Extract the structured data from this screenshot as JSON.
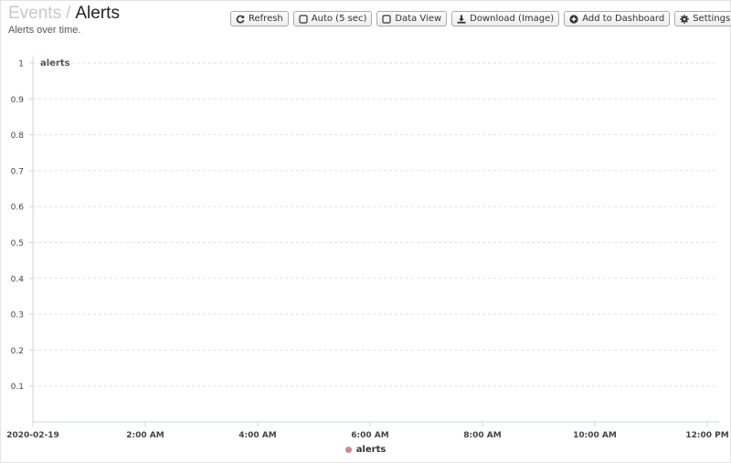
{
  "header": {
    "breadcrumb_parent": "Events",
    "breadcrumb_separator": "/",
    "breadcrumb_current": "Alerts",
    "subtitle": "Alerts over time."
  },
  "toolbar": {
    "refresh": {
      "label": "Refresh",
      "icon": "refresh-icon"
    },
    "auto": {
      "label": "Auto (5 sec)",
      "icon": "checkbox-icon"
    },
    "data_view": {
      "label": "Data View",
      "icon": "checkbox-icon"
    },
    "download": {
      "label": "Download (Image)",
      "icon": "download-icon"
    },
    "add_dashboard": {
      "label": "Add to Dashboard",
      "icon": "plus-circle-icon"
    },
    "settings": {
      "label": "Settings",
      "icon": "gear-icon"
    }
  },
  "colors": {
    "series": "#c98b8b",
    "grid": "#e2e2e2",
    "axis": "#c9d6e8"
  },
  "chart_data": {
    "type": "line",
    "title": "",
    "xlabel": "",
    "ylabel": "",
    "y_tick_labels": [
      "0.1",
      "0.2",
      "0.3",
      "0.4",
      "0.5",
      "0.6",
      "0.7",
      "0.8",
      "0.9",
      "1"
    ],
    "x_tick_labels": [
      "2020-02-19",
      "2:00 AM",
      "4:00 AM",
      "6:00 AM",
      "8:00 AM",
      "10:00 AM",
      "12:00 PM"
    ],
    "x_range": [
      "2020-02-19 00:00",
      "2020-02-19 12:00"
    ],
    "ylim": [
      0,
      1
    ],
    "grid": true,
    "legend_position": "bottom",
    "series": [
      {
        "name": "alerts",
        "color": "#c98b8b",
        "values": []
      }
    ],
    "annotations": [
      "alerts"
    ]
  }
}
